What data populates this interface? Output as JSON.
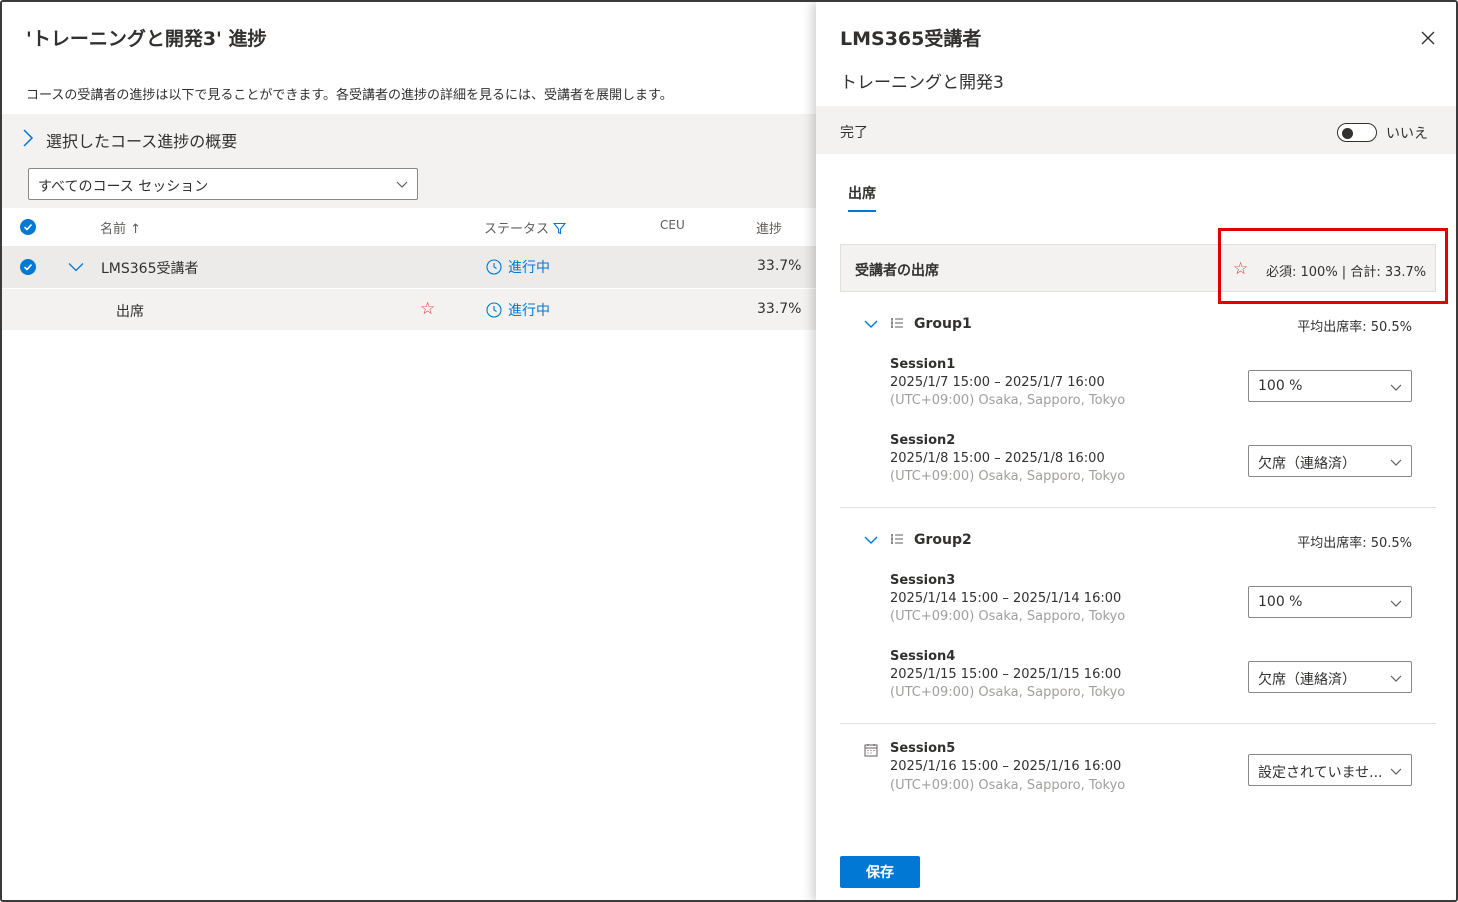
{
  "left": {
    "title": "'トレーニングと開発3' 進捗",
    "description": "コースの受講者の進捗は以下で見ることができます。各受講者の進捗の詳細を見るには、受講者を展開します。",
    "summary_label": "選択したコース進捗の概要",
    "session_filter": "すべてのコース セッション",
    "columns": {
      "name": "名前",
      "name_sort": "↑",
      "status": "ステータス",
      "ceu": "CEU",
      "progress": "進捗"
    },
    "rows": [
      {
        "name": "LMS365受講者",
        "status": "進行中",
        "progress": "33.7%"
      },
      {
        "name": "出席",
        "star": "☆",
        "status": "進行中",
        "progress": "33.7%"
      }
    ]
  },
  "panel": {
    "title": "LMS365受講者",
    "subtitle": "トレーニングと開発3",
    "complete_label": "完了",
    "complete_toggle": "いいえ",
    "tab": "出席",
    "attendance_title": "受講者の出席",
    "attendance_star": "☆",
    "attendance_stats": "必須: 100%  |  合計: 33.7%",
    "groups": [
      {
        "name": "Group1",
        "avg": "平均出席率: 50.5%",
        "sessions": [
          {
            "name": "Session1",
            "time": "2025/1/7 15:00 – 2025/1/7 16:00",
            "tz": "(UTC+09:00) Osaka, Sapporo, Tokyo",
            "value": "100 %"
          },
          {
            "name": "Session2",
            "time": "2025/1/8 15:00 – 2025/1/8 16:00",
            "tz": "(UTC+09:00) Osaka, Sapporo, Tokyo",
            "value": "欠席（連絡済）"
          }
        ]
      },
      {
        "name": "Group2",
        "avg": "平均出席率: 50.5%",
        "sessions": [
          {
            "name": "Session3",
            "time": "2025/1/14 15:00 – 2025/1/14 16:00",
            "tz": "(UTC+09:00) Osaka, Sapporo, Tokyo",
            "value": "100 %"
          },
          {
            "name": "Session4",
            "time": "2025/1/15 15:00 – 2025/1/15 16:00",
            "tz": "(UTC+09:00) Osaka, Sapporo, Tokyo",
            "value": "欠席（連絡済）"
          }
        ]
      }
    ],
    "standalone_session": {
      "name": "Session5",
      "time": "2025/1/16 15:00 – 2025/1/16 16:00",
      "tz": "(UTC+09:00) Osaka, Sapporo, Tokyo",
      "value": "設定されていませ..."
    },
    "save_label": "保存"
  },
  "colors": {
    "accent": "#0078d4",
    "highlight": "#e00000",
    "star": "#d13438"
  }
}
